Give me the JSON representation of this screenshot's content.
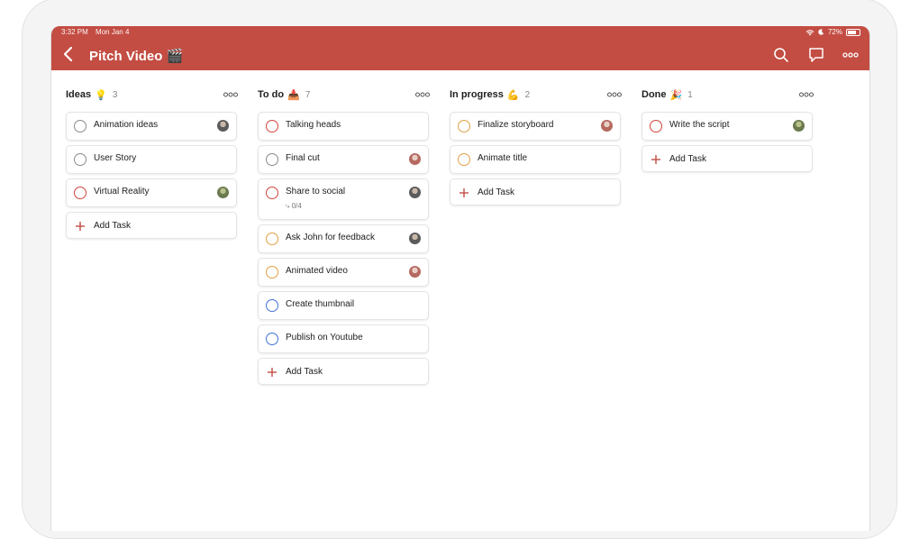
{
  "status_bar": {
    "time": "3:32 PM",
    "date": "Mon Jan 4",
    "battery": "72%"
  },
  "header": {
    "title": "Pitch Video 🎬"
  },
  "add_task_label": "Add Task",
  "colors": {
    "brand": "#c34d43",
    "priority_red": "#d1453b",
    "priority_orange": "#e0a043",
    "priority_blue": "#4073d6",
    "priority_none": "#8a8a8a"
  },
  "columns": [
    {
      "name": "Ideas",
      "emoji": "💡",
      "count": "3",
      "tasks": [
        {
          "label": "Animation ideas",
          "priority": "none",
          "avatar": "avatar-a"
        },
        {
          "label": "User Story",
          "priority": "none"
        },
        {
          "label": "Virtual Reality",
          "priority": "red",
          "avatar": "avatar-b"
        }
      ]
    },
    {
      "name": "To do",
      "emoji": "📥",
      "count": "7",
      "tasks": [
        {
          "label": "Talking heads",
          "priority": "red"
        },
        {
          "label": "Final cut",
          "priority": "none",
          "avatar": "avatar-c"
        },
        {
          "label": "Share to social",
          "priority": "red",
          "avatar": "avatar-a",
          "subtask": "0/4"
        },
        {
          "label": "Ask John for feedback",
          "priority": "orange",
          "avatar": "avatar-a"
        },
        {
          "label": "Animated video",
          "priority": "orange",
          "avatar": "avatar-c"
        },
        {
          "label": "Create thumbnail",
          "priority": "blue"
        },
        {
          "label": "Publish on Youtube",
          "priority": "blue"
        }
      ]
    },
    {
      "name": "In progress",
      "emoji": "💪",
      "count": "2",
      "tasks": [
        {
          "label": "Finalize storyboard",
          "priority": "orange",
          "avatar": "avatar-c"
        },
        {
          "label": "Animate title",
          "priority": "orange"
        }
      ]
    },
    {
      "name": "Done",
      "emoji": "🎉",
      "count": "1",
      "tasks": [
        {
          "label": "Write the script",
          "priority": "red",
          "avatar": "avatar-b"
        }
      ]
    }
  ]
}
